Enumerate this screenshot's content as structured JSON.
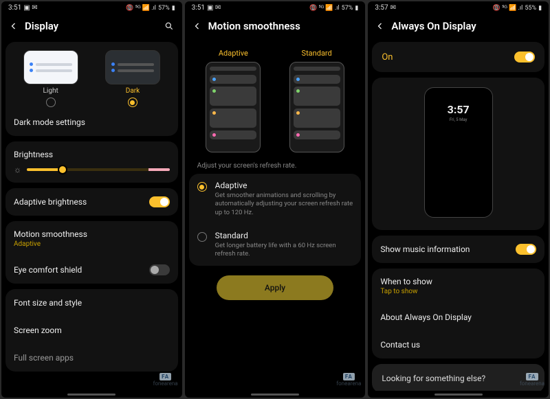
{
  "status": {
    "time1": "3:51",
    "time2": "3:51",
    "time3": "3:57",
    "icons_left": "▣ ✉",
    "battery1": "57%",
    "battery2": "57%",
    "battery3": "55%",
    "signal": "📵 ⁵ᴳ 📶 .ıl"
  },
  "watermark": {
    "logo": "FA",
    "text": "fonearena"
  },
  "screen1": {
    "title": "Display",
    "theme": {
      "light": "Light",
      "dark": "Dark",
      "selected": "dark"
    },
    "dark_mode_settings": "Dark mode settings",
    "brightness": {
      "label": "Brightness",
      "percent": 25
    },
    "adaptive_brightness": {
      "label": "Adaptive brightness",
      "on": true
    },
    "motion_smoothness": {
      "label": "Motion smoothness",
      "value": "Adaptive"
    },
    "eye_comfort": {
      "label": "Eye comfort shield",
      "on": false
    },
    "font_size": "Font size and style",
    "screen_zoom": "Screen zoom",
    "full_screen": "Full screen apps"
  },
  "screen2": {
    "title": "Motion smoothness",
    "preview_labels": {
      "adaptive": "Adaptive",
      "standard": "Standard"
    },
    "desc": "Adjust your screen's refresh rate.",
    "options": [
      {
        "key": "adaptive",
        "title": "Adaptive",
        "sub": "Get smoother animations and scrolling by automatically adjusting your screen refresh rate up to 120 Hz.",
        "selected": true
      },
      {
        "key": "standard",
        "title": "Standard",
        "sub": "Get longer battery life with a 60 Hz screen refresh rate.",
        "selected": false
      }
    ],
    "apply": "Apply"
  },
  "screen3": {
    "title": "Always On Display",
    "on_label": "On",
    "on": true,
    "clock": {
      "time": "3:57",
      "date": "Fri, 5 May"
    },
    "show_music": {
      "label": "Show music information",
      "on": true
    },
    "when_to_show": {
      "label": "When to show",
      "value": "Tap to show"
    },
    "about": "About Always On Display",
    "contact": "Contact us",
    "looking": "Looking for something else?"
  }
}
